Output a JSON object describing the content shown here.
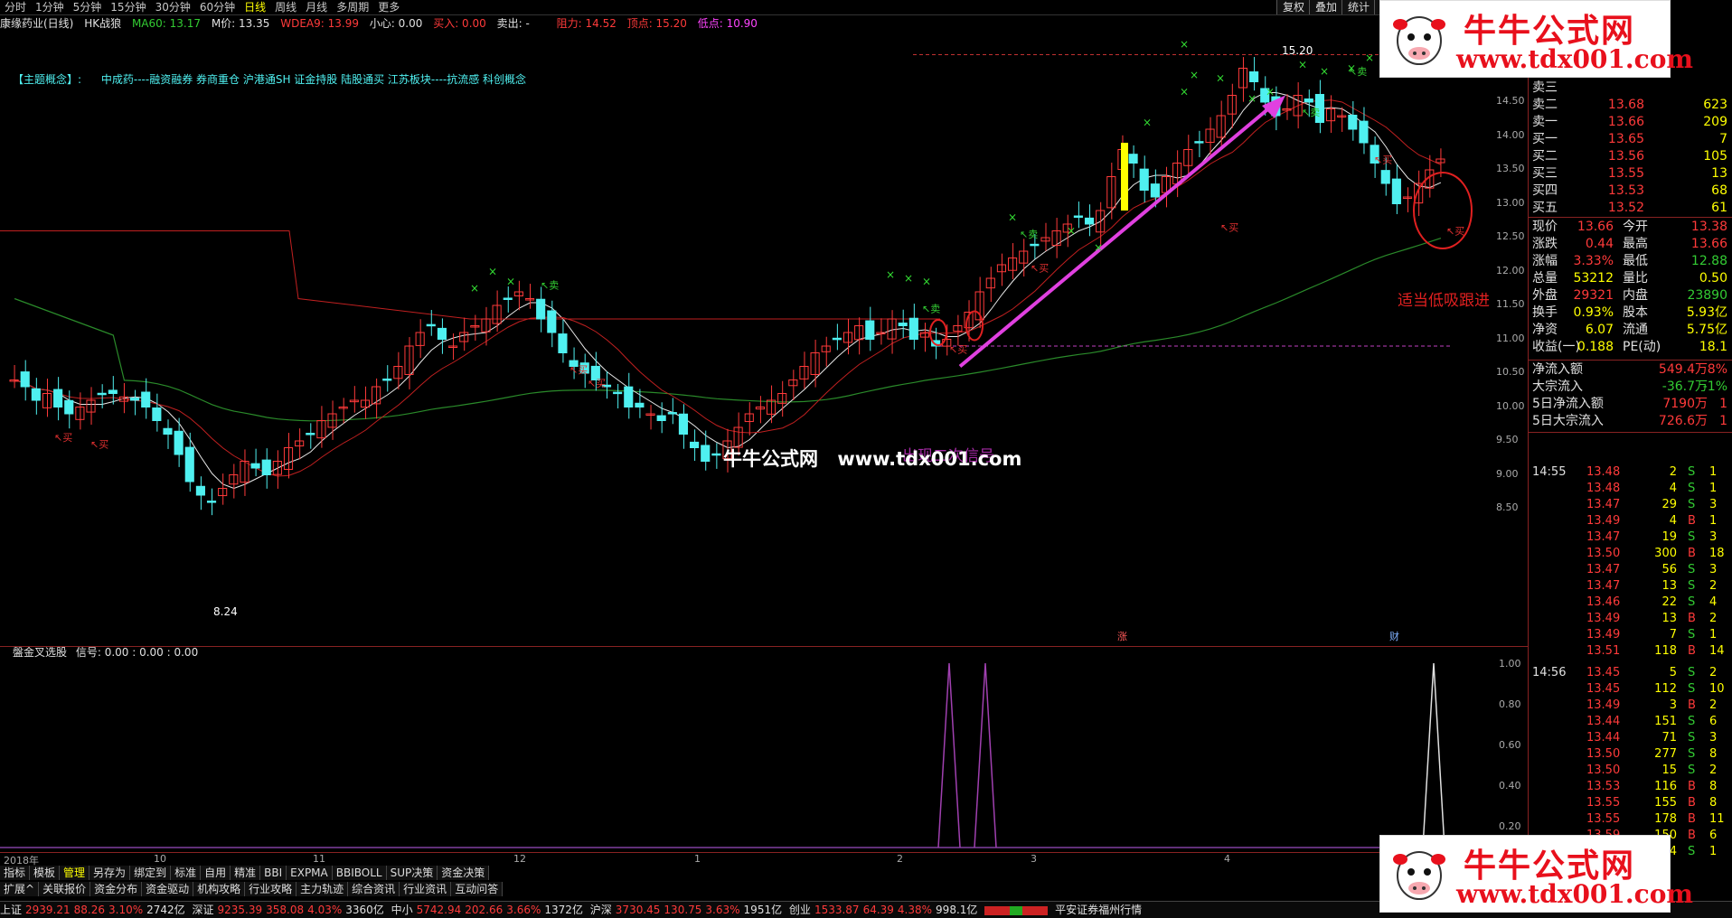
{
  "topbar": {
    "tabs": [
      "分时",
      "1分钟",
      "5分钟",
      "15分钟",
      "30分钟",
      "60分钟",
      "日线",
      "周线",
      "月线",
      "多周期",
      "更多"
    ],
    "active_tab": "日线",
    "right_buttons": [
      "复权",
      "叠加",
      "统计",
      "画"
    ]
  },
  "indicator_line": {
    "stock": "康缘药业(日线)",
    "formula": "HK战狼",
    "ma60": "MA60: 13.17",
    "mprice": "M价: 13.35",
    "wdea9": "WDEA9: 13.99",
    "careful": "小心: 0.00",
    "buy_in": "买入: 0.00",
    "sell_out": "卖出: -",
    "resist": "阻力: 14.52",
    "top": "顶点: 15.20",
    "low": "低点: 10.90"
  },
  "concept": {
    "label": "【主题概念】:",
    "text": "中成药----融资融券 券商重仓 沪港通SH 证金持股 陆股通买 江苏板块----抗流感 科创概念"
  },
  "chart_labels": {
    "high": "15.20",
    "low": "8.24",
    "signal_note": "出现二次信号",
    "advice": "适当低吸跟进",
    "buy": "买",
    "sell": "卖",
    "zhang": "涨",
    "cai": "财"
  },
  "watermark": {
    "brand": "牛牛公式网",
    "url": "www.tdx001.com"
  },
  "logo": {
    "title": "牛牛公式网",
    "url": "www.tdx001.com"
  },
  "y_axis": [
    "14.50",
    "14.00",
    "13.50",
    "13.00",
    "12.50",
    "12.00",
    "11.50",
    "11.00",
    "10.50",
    "10.00",
    "9.50",
    "9.00",
    "8.50"
  ],
  "sub_chart": {
    "title": "盤金叉选股",
    "signal": "信号: 0.00 : 0.00 : 0.00",
    "y_axis": [
      "1.00",
      "0.80",
      "0.60",
      "0.40",
      "0.20"
    ]
  },
  "dates": [
    "2018年",
    "10",
    "11",
    "12",
    "1",
    "2",
    "3",
    "4"
  ],
  "tabs_row1": [
    "指标",
    "模板",
    "管理",
    "另存为",
    "绑定到",
    "标准",
    "自用",
    "精准",
    "BBI",
    "EXPMA",
    "BBIBOLL",
    "SUP决策",
    "资金决策"
  ],
  "tabs_row2": [
    "扩展^",
    "关联报价",
    "资金分布",
    "资金驱动",
    "机构攻略",
    "行业攻略",
    "主力轨迹",
    "综合资讯",
    "行业资讯",
    "互动问答"
  ],
  "order_book": [
    {
      "label": "卖三",
      "price": "",
      "vol": ""
    },
    {
      "label": "卖二",
      "price": "13.68",
      "vol": "623"
    },
    {
      "label": "卖一",
      "price": "13.66",
      "vol": "209"
    },
    {
      "label": "买一",
      "price": "13.65",
      "vol": "7"
    },
    {
      "label": "买二",
      "price": "13.56",
      "vol": "105"
    },
    {
      "label": "买三",
      "price": "13.55",
      "vol": "13"
    },
    {
      "label": "买四",
      "price": "13.53",
      "vol": "68"
    },
    {
      "label": "买五",
      "price": "13.52",
      "vol": "61"
    }
  ],
  "quote_info": [
    {
      "k1": "现价",
      "v1": "13.66",
      "k2": "今开",
      "v2": "13.38"
    },
    {
      "k1": "涨跌",
      "v1": "0.44",
      "k2": "最高",
      "v2": "13.66"
    },
    {
      "k1": "涨幅",
      "v1": "3.33%",
      "k2": "最低",
      "v2": "12.88"
    },
    {
      "k1": "总量",
      "v1": "53212",
      "k2": "量比",
      "v2": "0.50"
    },
    {
      "k1": "外盘",
      "v1": "29321",
      "k2": "内盘",
      "v2": "23890"
    },
    {
      "k1": "换手",
      "v1": "0.93%",
      "k2": "股本",
      "v2": "5.93亿"
    },
    {
      "k1": "净资",
      "v1": "6.07",
      "k2": "流通",
      "v2": "5.75亿"
    },
    {
      "k1": "收益(一)",
      "v1": "0.188",
      "k2": "PE(动)",
      "v2": "18.1"
    }
  ],
  "fund_flow": [
    {
      "k": "净流入额",
      "v": "549.4万",
      "p": "8%"
    },
    {
      "k": "大宗流入",
      "v": "-36.7万",
      "p": "-1%"
    },
    {
      "k": "5日净流入额",
      "v": "7190万",
      "p": "1"
    },
    {
      "k": "5日大宗流入",
      "v": "726.6万",
      "p": "1"
    }
  ],
  "ticks": [
    {
      "t": "14:55",
      "p": "13.48",
      "v": "2",
      "s": "S",
      "n": "1"
    },
    {
      "t": "",
      "p": "13.48",
      "v": "4",
      "s": "S",
      "n": "1"
    },
    {
      "t": "",
      "p": "13.47",
      "v": "29",
      "s": "S",
      "n": "3"
    },
    {
      "t": "",
      "p": "13.49",
      "v": "4",
      "s": "B",
      "n": "1"
    },
    {
      "t": "",
      "p": "13.47",
      "v": "19",
      "s": "S",
      "n": "3"
    },
    {
      "t": "",
      "p": "13.50",
      "v": "300",
      "s": "B",
      "n": "18"
    },
    {
      "t": "",
      "p": "13.47",
      "v": "56",
      "s": "S",
      "n": "3"
    },
    {
      "t": "",
      "p": "13.47",
      "v": "13",
      "s": "S",
      "n": "2"
    },
    {
      "t": "",
      "p": "13.46",
      "v": "22",
      "s": "S",
      "n": "4"
    },
    {
      "t": "",
      "p": "13.49",
      "v": "13",
      "s": "B",
      "n": "2"
    },
    {
      "t": "",
      "p": "13.49",
      "v": "7",
      "s": "S",
      "n": "1"
    },
    {
      "t": "",
      "p": "13.51",
      "v": "118",
      "s": "B",
      "n": "14"
    },
    {
      "t": "14:56",
      "p": "13.45",
      "v": "5",
      "s": "S",
      "n": "2"
    },
    {
      "t": "",
      "p": "13.45",
      "v": "112",
      "s": "S",
      "n": "10"
    },
    {
      "t": "",
      "p": "13.49",
      "v": "3",
      "s": "B",
      "n": "2"
    },
    {
      "t": "",
      "p": "13.44",
      "v": "151",
      "s": "S",
      "n": "6"
    },
    {
      "t": "",
      "p": "13.44",
      "v": "71",
      "s": "S",
      "n": "3"
    },
    {
      "t": "",
      "p": "13.50",
      "v": "277",
      "s": "S",
      "n": "8"
    },
    {
      "t": "",
      "p": "13.50",
      "v": "15",
      "s": "S",
      "n": "2"
    },
    {
      "t": "",
      "p": "13.53",
      "v": "116",
      "s": "B",
      "n": "8"
    },
    {
      "t": "",
      "p": "13.55",
      "v": "155",
      "s": "B",
      "n": "8"
    },
    {
      "t": "",
      "p": "13.55",
      "v": "178",
      "s": "B",
      "n": "11"
    },
    {
      "t": "",
      "p": "13.59",
      "v": "150",
      "s": "B",
      "n": "6"
    },
    {
      "t": "",
      "p": "13.53",
      "v": "4",
      "s": "S",
      "n": "1"
    }
  ],
  "status_bar": {
    "sh": "上证",
    "sh_v": "2939.21",
    "sh_c": "88.26",
    "sh_p": "3.10%",
    "sh_a": "2742亿",
    "sz": "深证",
    "sz_v": "9235.39",
    "sz_c": "358.08",
    "sz_p": "4.03%",
    "sz_a": "3360亿",
    "zx": "中小",
    "zx_v": "5742.94",
    "zx_c": "202.66",
    "zx_p": "3.66%",
    "zx_a": "1372亿",
    "hs": "沪深",
    "hs_v": "3730.45",
    "hs_c": "130.75",
    "hs_p": "3.63%",
    "hs_a": "1951亿",
    "cy": "创业",
    "cy_v": "1533.87",
    "cy_c": "64.39",
    "cy_p": "4.38%",
    "cy_a": "998.1亿",
    "broker": "平安证券福州行情"
  },
  "colors": {
    "up": "#ff3a3a",
    "down": "#4ff0f0",
    "ma_green": "#2a8a2a",
    "ma_red": "#c02020",
    "arrow": "#e040e0",
    "signal": "#a040b0"
  }
}
